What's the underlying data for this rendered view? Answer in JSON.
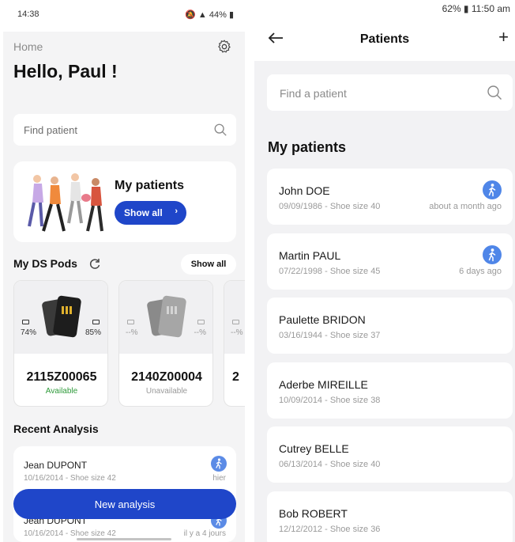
{
  "left": {
    "status_time": "14:38",
    "status_battery": "44%",
    "breadcrumb": "Home",
    "greeting": "Hello, Paul !",
    "search_placeholder": "Find patient",
    "patients_card": {
      "title": "My patients",
      "button": "Show all"
    },
    "pods": {
      "title": "My DS Pods",
      "show_all": "Show all",
      "items": [
        {
          "id": "2115Z00065",
          "status": "Available",
          "battery_left": "74%",
          "battery_right": "85%",
          "status_color": "#2e9a3a"
        },
        {
          "id": "2140Z00004",
          "status": "Unavailable",
          "battery_left": "--%",
          "battery_right": "--%",
          "status_color": "#9a9a9a"
        },
        {
          "id": "2",
          "status": "",
          "battery_left": "--%",
          "battery_right": "",
          "status_color": "#9a9a9a"
        }
      ]
    },
    "recent": {
      "title": "Recent Analysis",
      "items": [
        {
          "name": "Jean DUPONT",
          "sub": "10/16/2014 - Shoe size 42",
          "when": "hier"
        },
        {
          "name": "Jean DUPONT",
          "sub": "10/16/2014 - Shoe size 42",
          "when": "il y a 4 jours"
        }
      ]
    },
    "new_analysis": "New analysis"
  },
  "right": {
    "status_text": "62% ▮ 11:50 am",
    "title": "Patients",
    "search_placeholder": "Find a patient",
    "section_title": "My patients",
    "patients": [
      {
        "name": "John DOE",
        "sub": "09/09/1986 - Shoe size 40",
        "when": "about a month ago",
        "walk": true
      },
      {
        "name": "Martin PAUL",
        "sub": "07/22/1998 - Shoe size 45",
        "when": "6 days ago",
        "walk": true
      },
      {
        "name": "Paulette BRIDON",
        "sub": "03/16/1944 - Shoe size 37",
        "when": "",
        "walk": false
      },
      {
        "name": "Aderbe MIREILLE",
        "sub": "10/09/2014 - Shoe size 38",
        "when": "",
        "walk": false
      },
      {
        "name": "Cutrey BELLE",
        "sub": "06/13/2014 - Shoe size 40",
        "when": "",
        "walk": false
      },
      {
        "name": "Bob ROBERT",
        "sub": "12/12/2012 - Shoe size 36",
        "when": "",
        "walk": false
      }
    ]
  },
  "colors": {
    "accent": "#1f46c9",
    "walk_badge": "#4f86e8",
    "available": "#2e9a3a"
  },
  "icons": [
    "gear-icon",
    "search-icon",
    "refresh-icon",
    "back-arrow-icon",
    "plus-icon",
    "walking-person-icon",
    "battery-icon",
    "chevron-right-icon"
  ]
}
